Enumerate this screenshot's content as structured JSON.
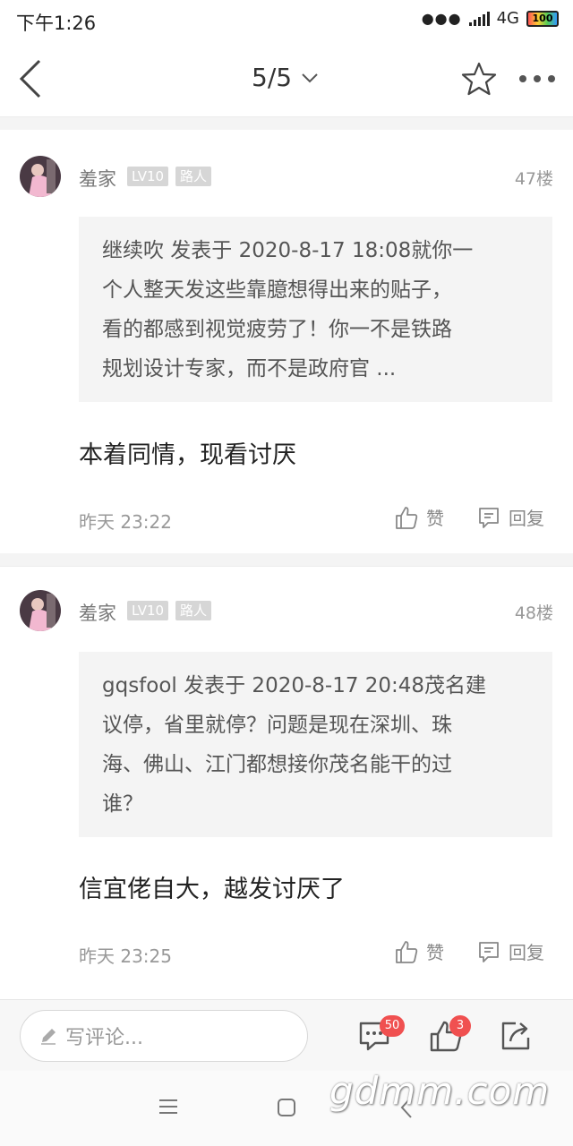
{
  "status_bar": {
    "time": "下午1:26",
    "network": "4G",
    "battery": "100"
  },
  "header": {
    "page_indicator": "5/5"
  },
  "posts": [
    {
      "username": "羞家",
      "level": "LV10",
      "title": "路人",
      "floor": "47楼",
      "quote_lines": [
        "继续吹 发表于 2020-8-17 18:08就你一",
        "个人整天发这些靠臆想得出来的贴子，",
        "看的都感到视觉疲劳了！你一不是铁路",
        "规划设计专家，而不是政府官 ..."
      ],
      "content": "本着同情，现看讨厌",
      "time": "昨天 23:22",
      "like_label": "赞",
      "reply_label": "回复"
    },
    {
      "username": "羞家",
      "level": "LV10",
      "title": "路人",
      "floor": "48楼",
      "quote_lines": [
        "gqsfool 发表于 2020-8-17 20:48茂名建",
        "议停，省里就停？问题是现在深圳、珠",
        "海、佛山、江门都想接你茂名能干的过",
        "谁？"
      ],
      "content": "信宜佬自大，越发讨厌了",
      "time": "昨天 23:25",
      "like_label": "赞",
      "reply_label": "回复"
    }
  ],
  "bottom_bar": {
    "comment_placeholder": "写评论...",
    "comment_count": "50",
    "like_count": "3"
  },
  "watermark": "gdmm.com",
  "colors": {
    "badge_red": "#f05050",
    "badge_gray": "#d6d6d6",
    "quote_bg": "#f4f4f4"
  }
}
